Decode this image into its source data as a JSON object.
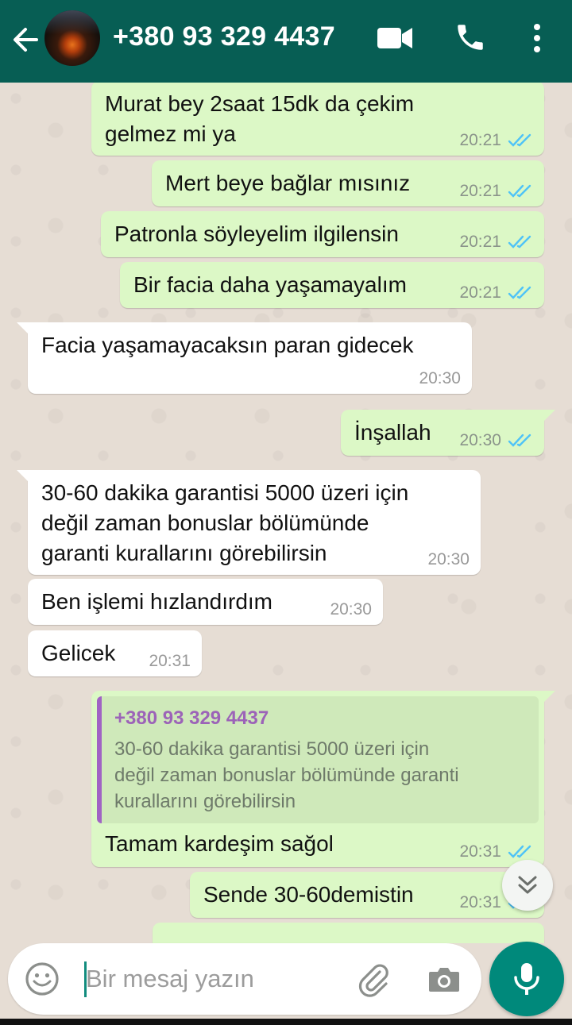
{
  "header": {
    "contact_name": "+380 93 329 4437",
    "back_icon": "arrow-left-icon",
    "video_icon": "videocam-icon",
    "call_icon": "phone-icon",
    "menu_icon": "more-vert-icon",
    "color": "#075e54"
  },
  "messages": [
    {
      "direction": "out",
      "text": "Murat bey 2saat 15dk da çekim\ngelmez mi ya",
      "time": "20:21",
      "status": "read"
    },
    {
      "direction": "out",
      "text": "Mert beye bağlar mısınız",
      "time": "20:21",
      "status": "read"
    },
    {
      "direction": "out",
      "text": "Patronla söyleyelim ilgilensin",
      "time": "20:21",
      "status": "read"
    },
    {
      "direction": "out",
      "text": "Bir facia daha yaşamayalım",
      "time": "20:21",
      "status": "read"
    },
    {
      "direction": "in",
      "text": "Facia yaşamayacaksın paran gidecek",
      "time": "20:30"
    },
    {
      "direction": "out",
      "text": "İnşallah",
      "time": "20:30",
      "status": "read"
    },
    {
      "direction": "in",
      "text": "30-60 dakika garantisi 5000 üzeri için\ndeğil zaman bonuslar bölümünde\ngaranti kurallarını görebilirsin",
      "time": "20:30"
    },
    {
      "direction": "in",
      "text": "Ben işlemi hızlandırdım",
      "time": "20:30"
    },
    {
      "direction": "in",
      "text": "Gelicek",
      "time": "20:31"
    },
    {
      "direction": "out",
      "quote_author": "+380 93 329 4437",
      "quote_text": "30-60 dakika garantisi 5000 üzeri için\ndeğil zaman bonuslar bölümünde garanti\nkurallarını görebilirsin",
      "text": "Tamam kardeşim sağol",
      "time": "20:31",
      "status": "read"
    },
    {
      "direction": "out",
      "text": "Sende 30-60demistin",
      "time": "20:31",
      "status": "read"
    }
  ],
  "scroll_down_icon": "double-chevron-down-icon",
  "input": {
    "placeholder": "Bir mesaj yazın",
    "value": "",
    "emoji_icon": "emoji-icon",
    "attach_icon": "paperclip-icon",
    "camera_icon": "camera-icon"
  },
  "mic_icon": "mic-icon",
  "colors": {
    "outgoing_bubble": "#dcf8c6",
    "incoming_bubble": "#ffffff",
    "read_ticks": "#4fc3f7",
    "accent": "#00897b",
    "quote_author": "#9c63b8"
  }
}
